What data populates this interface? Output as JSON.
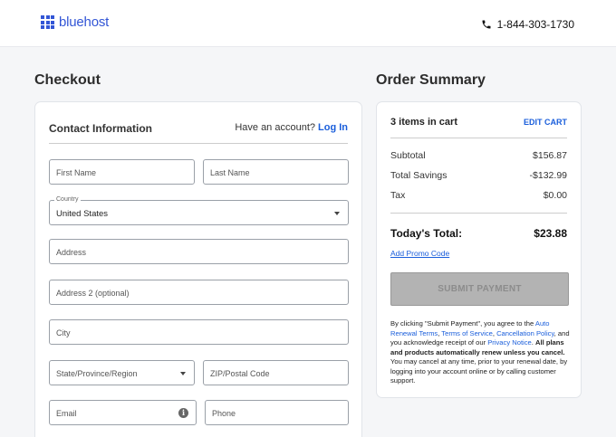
{
  "header": {
    "logo_text": "bluehost",
    "phone": "1-844-303-1730"
  },
  "checkout": {
    "title": "Checkout",
    "contact_title": "Contact Information",
    "have_account": "Have an account?",
    "login": "Log In",
    "fields": {
      "first_name": "First Name",
      "last_name": "Last Name",
      "country_label": "Country",
      "country_value": "United States",
      "address": "Address",
      "address2": "Address 2 (optional)",
      "city": "City",
      "state": "State/Province/Region",
      "zip": "ZIP/Postal Code",
      "email": "Email",
      "phone": "Phone"
    }
  },
  "summary": {
    "title": "Order Summary",
    "items_count": "3 items in cart",
    "edit_cart": "EDIT CART",
    "subtotal_label": "Subtotal",
    "subtotal_value": "$156.87",
    "savings_label": "Total Savings",
    "savings_value": "-$132.99",
    "tax_label": "Tax",
    "tax_value": "$0.00",
    "total_label": "Today's Total:",
    "total_value": "$23.88",
    "promo": "Add Promo Code",
    "submit": "SUBMIT PAYMENT",
    "legal": {
      "p1": "By clicking \"Submit Payment\", you agree to the ",
      "link1": "Auto Renewal Terms",
      "p2": ", ",
      "link2": "Terms of Service",
      "p3": ", ",
      "link3": "Cancellation Policy",
      "p4": ", and you acknowledge receipt of our ",
      "link4": "Privacy Notice",
      "p5": ". ",
      "bold": "All plans and products automatically renew unless you cancel.",
      "p6": " You may cancel at any time, prior to your renewal date, by logging into your account online or by calling customer support."
    }
  },
  "colors": {
    "brand": "#3356d6",
    "link": "#1a5edb",
    "submit_disabled": "#b3b3b3"
  }
}
